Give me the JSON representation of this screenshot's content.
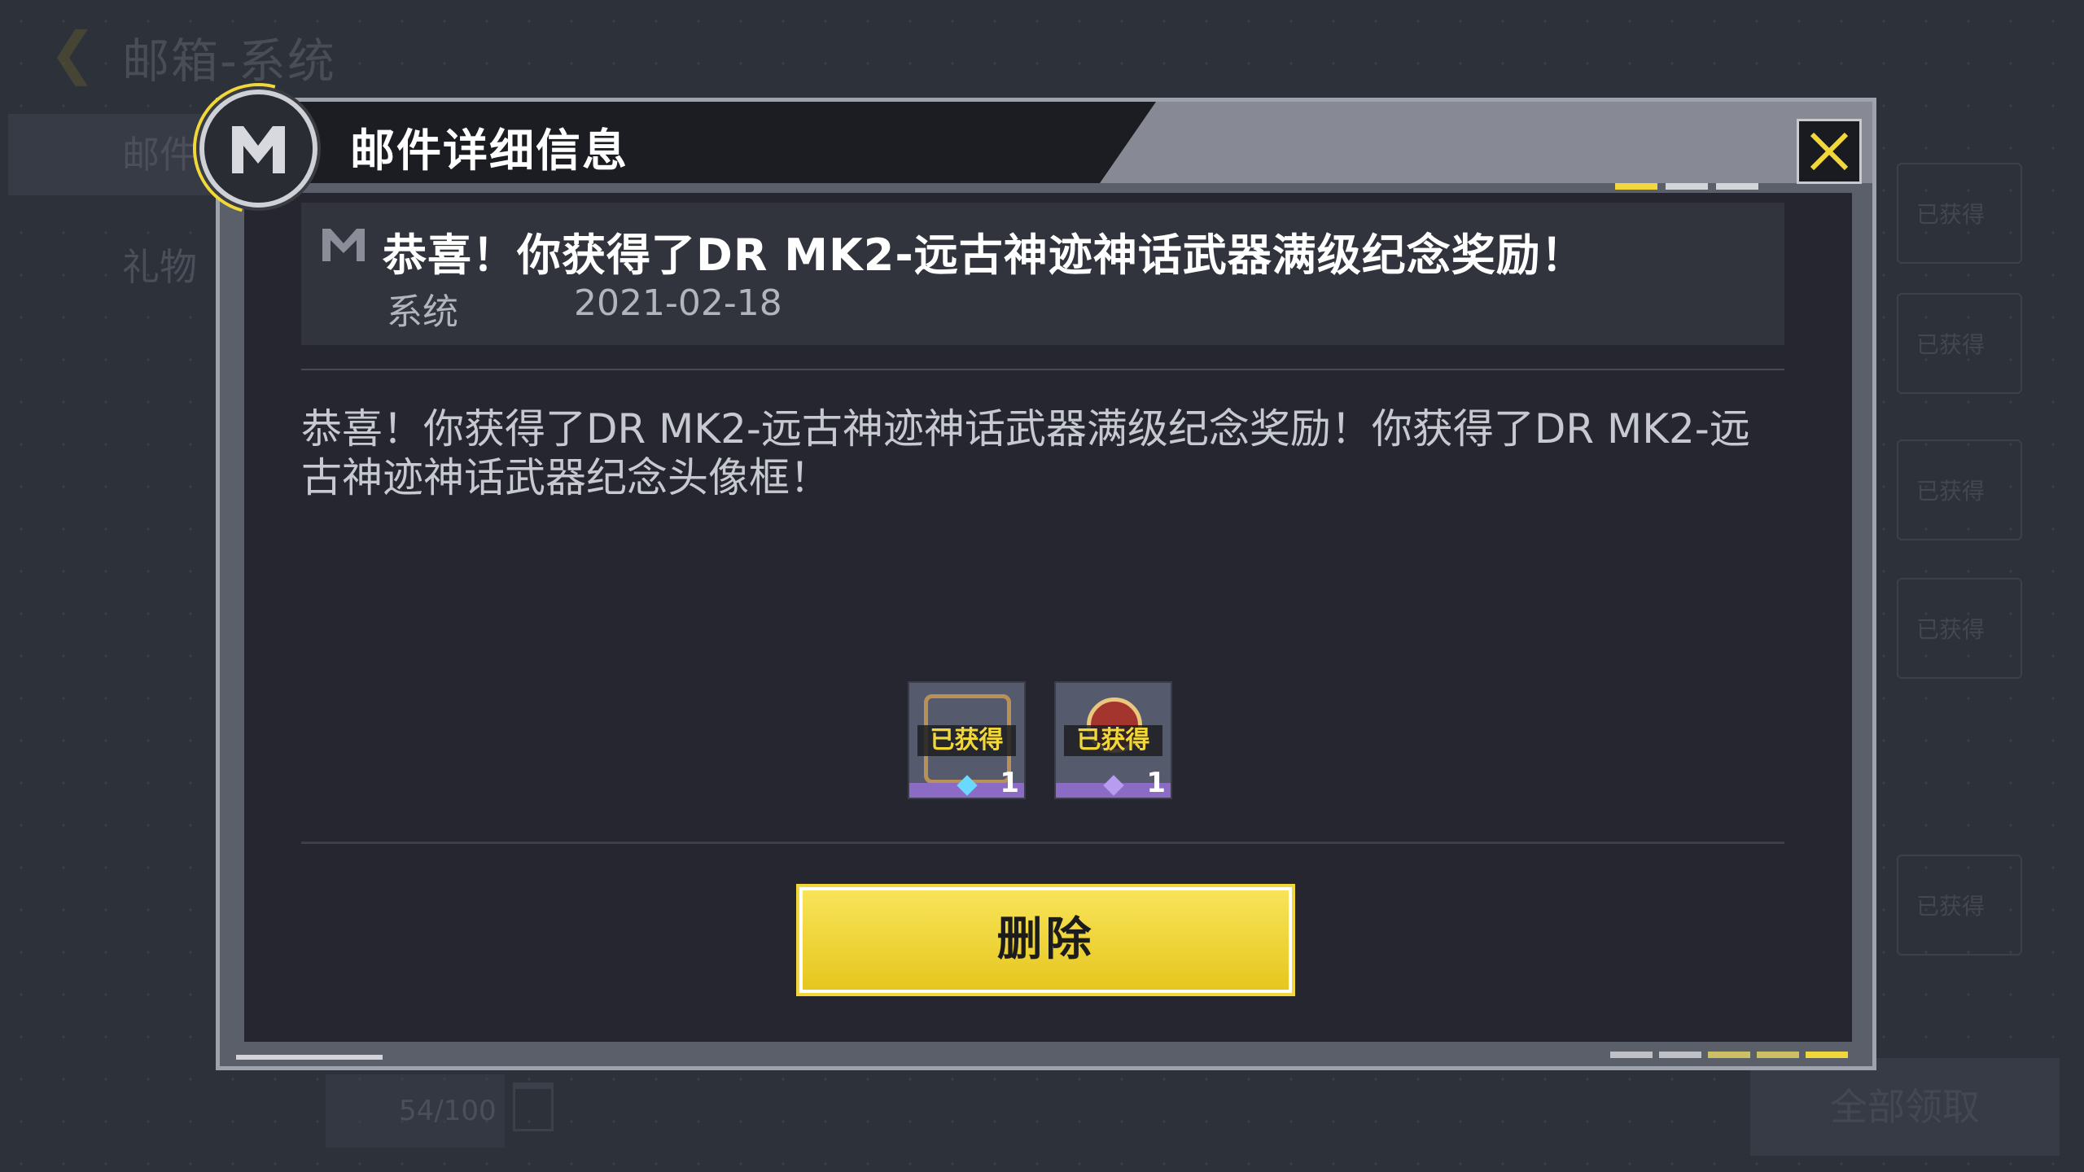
{
  "background": {
    "title": "邮箱-系统",
    "tabs": [
      "邮件",
      "礼物"
    ],
    "right_item_badge": "已获得",
    "counter": "54/100",
    "collect_all": "全部领取"
  },
  "dialog": {
    "title": "邮件详细信息",
    "close_icon": "close-x-icon",
    "mail": {
      "subject": "恭喜！你获得了DR MK2-远古神迹神话武器满级纪念奖励！",
      "sender": "系统",
      "date": "2021-02-18",
      "body": "恭喜！你获得了DR MK2-远古神迹神话武器满级纪念奖励！你获得了DR MK2-远古神迹神话武器纪念头像框！"
    },
    "rewards": [
      {
        "status": "已获得",
        "quantity": "1"
      },
      {
        "status": "已获得",
        "quantity": "1"
      }
    ],
    "delete_label": "删除"
  },
  "colors": {
    "accent": "#f2d73a",
    "panel": "#25262f",
    "header_dark": "#1c1d22"
  }
}
